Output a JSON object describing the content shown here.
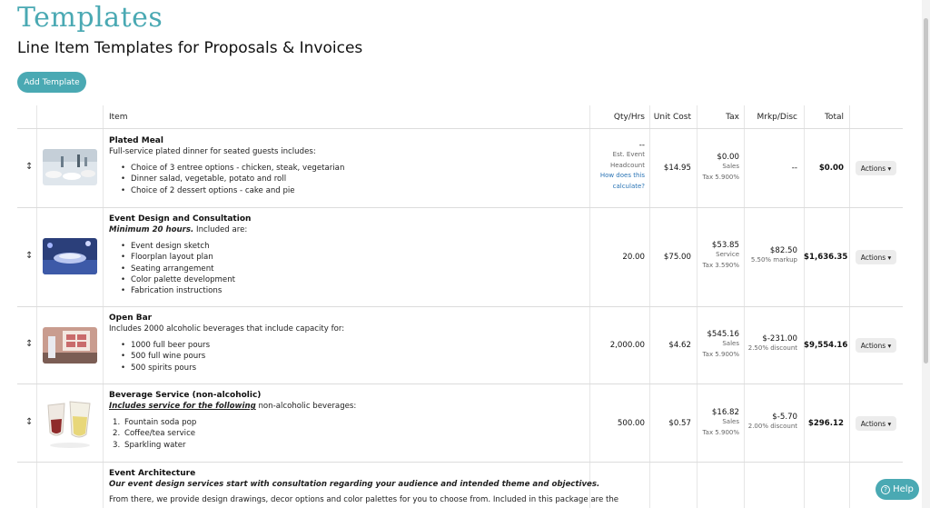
{
  "page": {
    "title": "Templates",
    "subtitle": "Line Item Templates for Proposals & Invoices",
    "add_button": "Add Template",
    "help_button": "Help"
  },
  "table": {
    "headers": {
      "item": "Item",
      "qty": "Qty/Hrs",
      "unit_cost": "Unit Cost",
      "tax": "Tax",
      "markup": "Mrkp/Disc",
      "total": "Total"
    },
    "rows": [
      {
        "name": "Plated Meal",
        "desc": "Full-service plated dinner for seated guests includes:",
        "bullets": [
          "Choice of 3 entree options - chicken, steak, vegetarian",
          "Dinner salad, vegetable, potato and roll",
          "Choice of 2 dessert options - cake and pie"
        ],
        "qty_dash": "--",
        "qty_note1": "Est. Event",
        "qty_note2": "Headcount",
        "qty_link1": "How does this",
        "qty_link2": "calculate?",
        "unit_cost": "$14.95",
        "tax": "$0.00",
        "tax_type": "Sales",
        "tax_rate": "Tax 5.900%",
        "markup": "--",
        "total": "$0.00",
        "actions": "Actions ▾"
      },
      {
        "name": "Event Design and Consultation",
        "desc_bold": "Minimum 20 hours.",
        "desc": " Included are:",
        "bullets": [
          "Event design sketch",
          "Floorplan layout plan",
          "Seating arrangement",
          "Color palette development",
          "Fabrication instructions"
        ],
        "qty": "20.00",
        "unit_cost": "$75.00",
        "tax": "$53.85",
        "tax_type": "Service",
        "tax_rate": "Tax 3.590%",
        "markup": "$82.50",
        "markup_note": "5.50% markup",
        "total": "$1,636.35",
        "actions": "Actions ▾"
      },
      {
        "name": "Open Bar",
        "desc": "Includes 2000 alcoholic beverages that include capacity for:",
        "bullets": [
          "1000 full beer pours",
          "500 full wine pours",
          "500 spirits pours"
        ],
        "qty": "2,000.00",
        "unit_cost": "$4.62",
        "tax": "$545.16",
        "tax_type": "Sales",
        "tax_rate": "Tax 5.900%",
        "markup": "$-231.00",
        "markup_note": "2.50% discount",
        "total": "$9,554.16",
        "actions": "Actions ▾"
      },
      {
        "name": "Beverage Service (non-alcoholic)",
        "desc_bold": "Includes service for the following",
        "desc": " non-alcoholic beverages:",
        "bullets": [
          "Fountain soda pop",
          "Coffee/tea service",
          "Sparkling water"
        ],
        "qty": "500.00",
        "unit_cost": "$0.57",
        "tax": "$16.82",
        "tax_type": "Sales",
        "tax_rate": "Tax 5.900%",
        "markup": "$-5.70",
        "markup_note": "2.00% discount",
        "total": "$296.12",
        "actions": "Actions ▾"
      },
      {
        "name": "Event Architecture",
        "desc_bold": "Our event design services start with consultation regarding your audience and intended theme and objectives.",
        "desc": "From there, we provide design drawings, decor options and color palettes for you to choose from. Included in this package are the"
      }
    ]
  },
  "colors": {
    "accent": "#4aa9b3",
    "link": "#2a74b5"
  }
}
